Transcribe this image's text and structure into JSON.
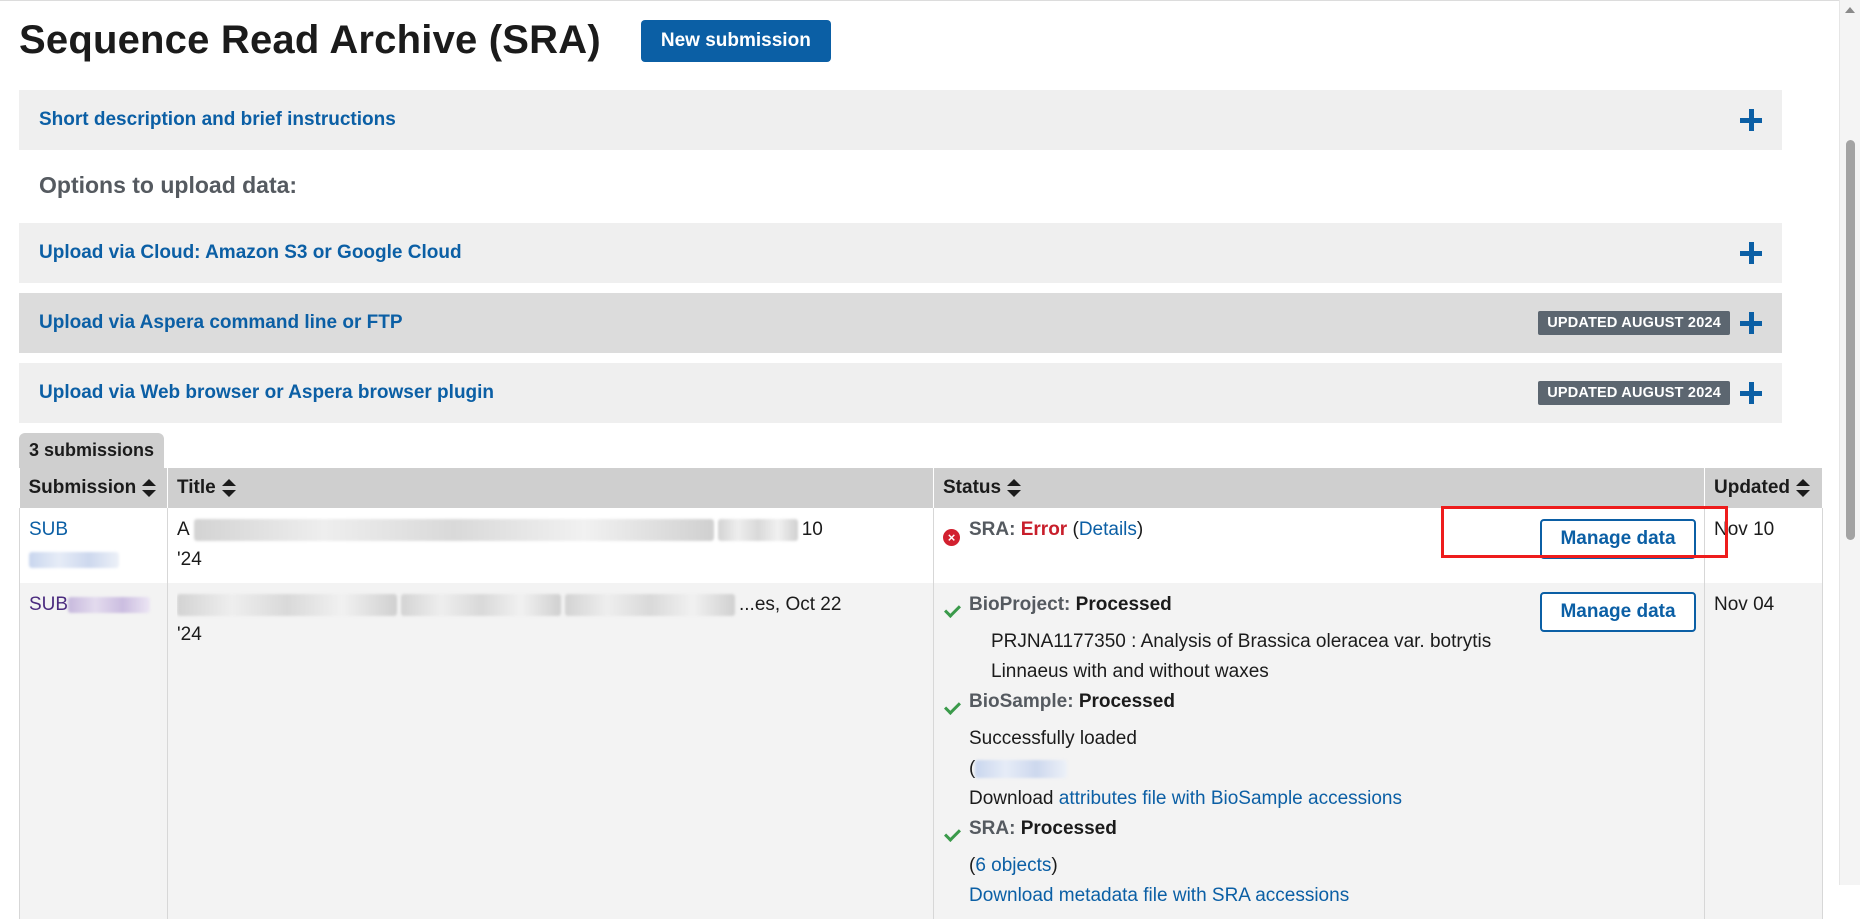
{
  "page": {
    "title": "Sequence Read Archive (SRA)",
    "new_submission_label": "New submission"
  },
  "accordions": [
    {
      "label": "Short description and brief instructions",
      "badge": ""
    },
    {
      "label": "Upload via Cloud: Amazon S3 or Google Cloud",
      "badge": ""
    },
    {
      "label": "Upload via Aspera command line or FTP",
      "badge": "UPDATED AUGUST 2024"
    },
    {
      "label": "Upload via Web browser or Aspera browser plugin",
      "badge": "UPDATED AUGUST 2024"
    }
  ],
  "options_heading": "Options to upload data:",
  "submissions_tab": "3 submissions",
  "table": {
    "headers": [
      "Submission",
      "Title",
      "Status",
      "Updated"
    ],
    "rows": [
      {
        "submission": "SUB",
        "title_prefix": "A",
        "title_mid": "of B",
        "title_tail": "10",
        "title_line2": "'24",
        "status": {
          "service": "SRA:",
          "state": "Error",
          "open_paren": "(",
          "details_label": "Details",
          "close_paren": ")"
        },
        "manage_label": "Manage data",
        "updated": "Nov 10"
      },
      {
        "submission": "SUB",
        "title_mid": "...alysis of Br",
        "title_mid2": "...acea var. botryti",
        "title_tail": "...es, Oct 22",
        "title_line2": "'24",
        "bioproject": {
          "service": "BioProject:",
          "state": "Processed",
          "detail": "PRJNA1177350 : Analysis of Brassica oleracea var. botrytis Linnaeus with and without waxes"
        },
        "biosample": {
          "service": "BioSample:",
          "state": "Processed",
          "loaded": "Successfully loaded",
          "download_prefix": "Download",
          "download_link": "attributes file with BioSample accessions"
        },
        "sra": {
          "service": "SRA:",
          "state": "Processed",
          "objects_link": "6 objects",
          "metadata_link": "Download metadata file with SRA accessions"
        },
        "manage_label": "Manage data",
        "updated": "Nov 04"
      }
    ]
  },
  "colors": {
    "accent": "#0b5fa5",
    "error": "#c81e2b",
    "success": "#3a9a4a",
    "highlight": "#ee1c1c"
  }
}
